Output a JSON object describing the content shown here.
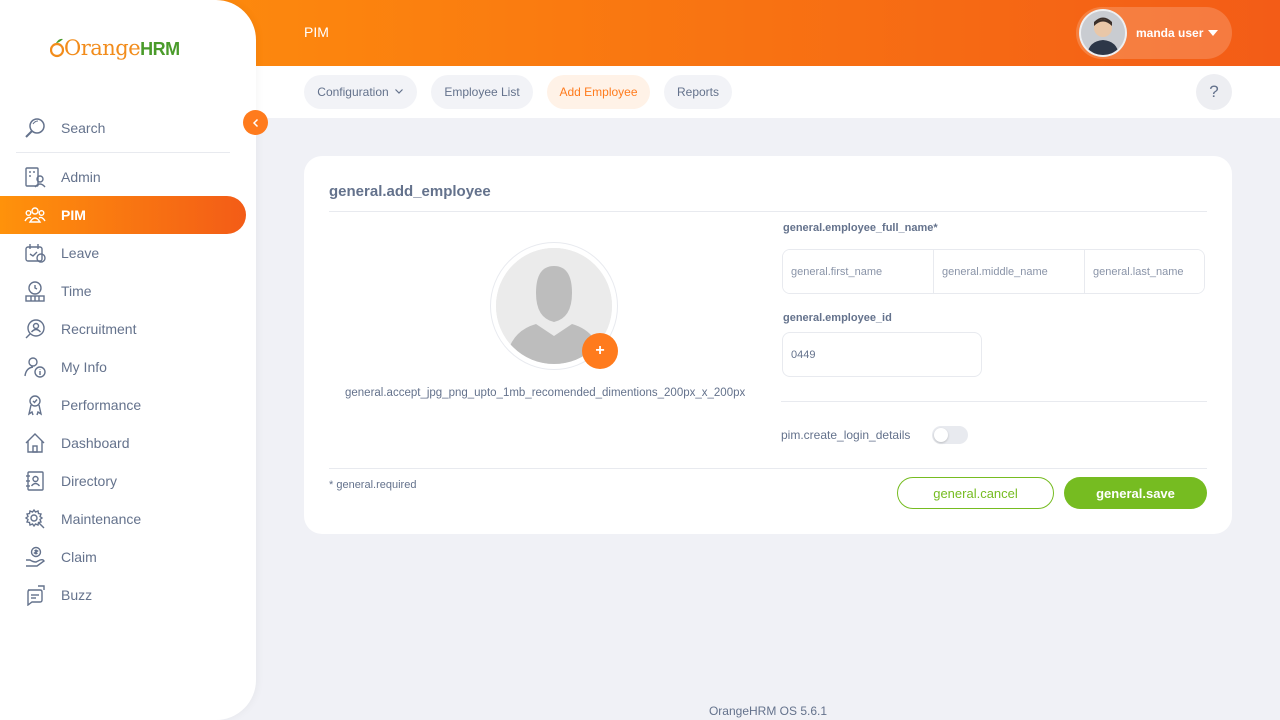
{
  "brand": {
    "part1": "Orange",
    "part2": "HRM"
  },
  "header": {
    "module_title": "PIM",
    "user_name": "manda user"
  },
  "sidebar": {
    "search_label": "Search",
    "items": [
      {
        "label": "Admin",
        "icon": "admin-icon",
        "active": false
      },
      {
        "label": "PIM",
        "icon": "pim-icon",
        "active": true
      },
      {
        "label": "Leave",
        "icon": "leave-icon",
        "active": false
      },
      {
        "label": "Time",
        "icon": "time-icon",
        "active": false
      },
      {
        "label": "Recruitment",
        "icon": "recruitment-icon",
        "active": false
      },
      {
        "label": "My Info",
        "icon": "my-info-icon",
        "active": false
      },
      {
        "label": "Performance",
        "icon": "performance-icon",
        "active": false
      },
      {
        "label": "Dashboard",
        "icon": "dashboard-icon",
        "active": false
      },
      {
        "label": "Directory",
        "icon": "directory-icon",
        "active": false
      },
      {
        "label": "Maintenance",
        "icon": "maintenance-icon",
        "active": false
      },
      {
        "label": "Claim",
        "icon": "claim-icon",
        "active": false
      },
      {
        "label": "Buzz",
        "icon": "buzz-icon",
        "active": false
      }
    ]
  },
  "topnav": {
    "tabs": [
      {
        "label": "Configuration",
        "active": false,
        "dropdown": true
      },
      {
        "label": "Employee List",
        "active": false
      },
      {
        "label": "Add Employee",
        "active": true
      },
      {
        "label": "Reports",
        "active": false
      }
    ],
    "help_label": "?"
  },
  "form": {
    "title": "general.add_employee",
    "photo_hint": "general.accept_jpg_png_upto_1mb_recomended_dimentions_200px_x_200px",
    "photo_add_label": "+",
    "full_name_label": "general.employee_full_name*",
    "first_name_placeholder": "general.first_name",
    "middle_name_placeholder": "general.middle_name",
    "last_name_placeholder": "general.last_name",
    "employee_id_label": "general.employee_id",
    "employee_id_value": "0449",
    "create_login_label": "pim.create_login_details",
    "create_login_enabled": false,
    "required_note": "* general.required",
    "cancel_label": "general.cancel",
    "save_label": "general.save"
  },
  "footer": {
    "version": "OrangeHRM OS 5.6.1"
  },
  "colors": {
    "accent": "#ff7b1d",
    "accent_gradient_start": "#ff920b",
    "accent_gradient_end": "#f35c17",
    "save_green": "#76bc21",
    "text_muted": "#64728c",
    "page_bg": "#f0f1f6"
  }
}
